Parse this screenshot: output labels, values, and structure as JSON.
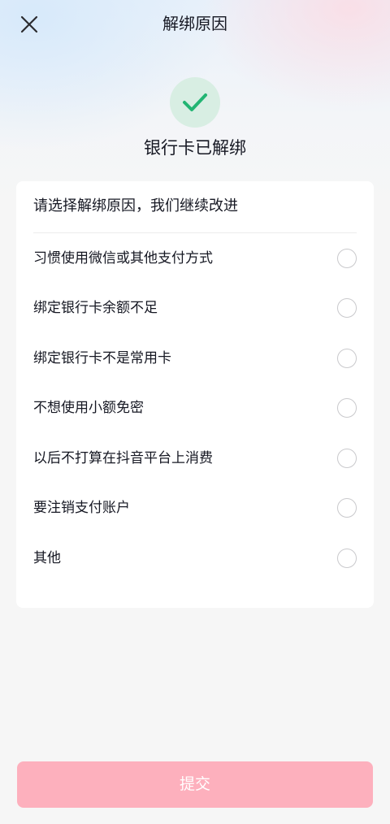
{
  "header": {
    "title": "解绑原因",
    "close_icon": "close-icon"
  },
  "status": {
    "icon": "check-icon",
    "text": "银行卡已解绑",
    "accent_color": "#22b573"
  },
  "reasons": {
    "title": "请选择解绑原因，我们继续改进",
    "items": [
      {
        "label": "习惯使用微信或其他支付方式",
        "selected": false
      },
      {
        "label": "绑定银行卡余额不足",
        "selected": false
      },
      {
        "label": "绑定银行卡不是常用卡",
        "selected": false
      },
      {
        "label": "不想使用小额免密",
        "selected": false
      },
      {
        "label": "以后不打算在抖音平台上消费",
        "selected": false
      },
      {
        "label": "要注销支付账户",
        "selected": false
      },
      {
        "label": "其他",
        "selected": false
      }
    ]
  },
  "submit": {
    "label": "提交",
    "color": "#fdb0bd",
    "enabled": false
  }
}
